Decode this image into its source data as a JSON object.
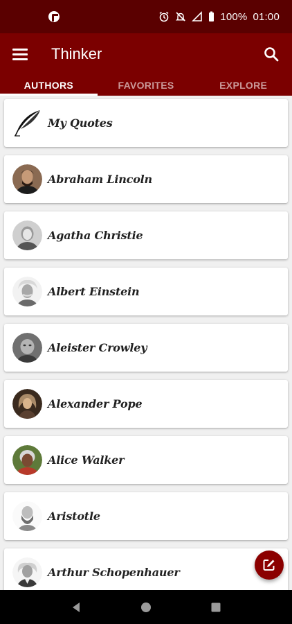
{
  "status_bar": {
    "battery": "100%",
    "time": "01:00",
    "icons": [
      "app-notification-icon",
      "alarm-icon",
      "notifications-off-icon",
      "signal-icon",
      "battery-icon"
    ]
  },
  "app_bar": {
    "title": "Thinker",
    "menu_icon": "menu-icon",
    "search_icon": "search-icon"
  },
  "tabs": [
    {
      "label": "AUTHORS",
      "active": true
    },
    {
      "label": "FAVORITES",
      "active": false
    },
    {
      "label": "EXPLORE",
      "active": false
    }
  ],
  "authors": [
    {
      "name": "My Quotes",
      "icon": "quill-icon"
    },
    {
      "name": "Abraham Lincoln",
      "icon": "portrait"
    },
    {
      "name": "Agatha Christie",
      "icon": "portrait"
    },
    {
      "name": "Albert Einstein",
      "icon": "portrait"
    },
    {
      "name": "Aleister Crowley",
      "icon": "portrait"
    },
    {
      "name": "Alexander Pope",
      "icon": "portrait"
    },
    {
      "name": "Alice Walker",
      "icon": "portrait"
    },
    {
      "name": "Aristotle",
      "icon": "portrait"
    },
    {
      "name": "Arthur Schopenhauer",
      "icon": "portrait"
    }
  ],
  "fab": {
    "icon": "edit-icon"
  },
  "nav_bar": {
    "icons": [
      "back-icon",
      "home-icon",
      "recents-icon"
    ]
  },
  "colors": {
    "status_bar": "#5a0000",
    "primary": "#7b0000",
    "fab": "#8b0000",
    "background": "#f0f0f0"
  }
}
